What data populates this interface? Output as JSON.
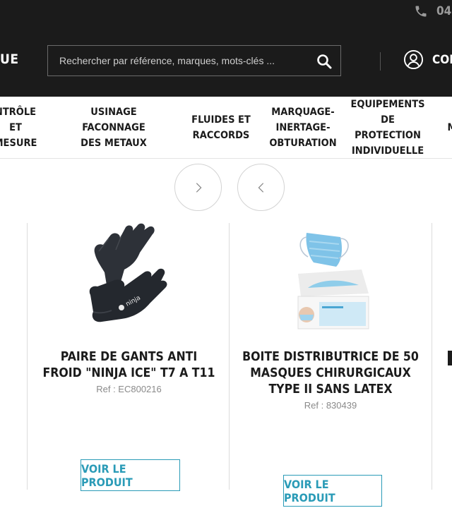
{
  "header": {
    "phone": "04",
    "brand_fragment": "UE",
    "search": {
      "placeholder": "Rechercher par référence, marques, mots-clés ..."
    },
    "account_label": "CONN"
  },
  "nav": {
    "items": [
      {
        "label": "NTRÔLE ET\nMESURE"
      },
      {
        "label": "USINAGE FACONNAGE\nDES METAUX"
      },
      {
        "label": "FLUIDES ET\nRACCORDS"
      },
      {
        "label": "MARQUAGE-\nINERTAGE-\nOBTURATION"
      },
      {
        "label": "EQUIPEMENTS DE\nPROTECTION\nINDIVIDUELLE"
      },
      {
        "label": "M"
      }
    ]
  },
  "carousel": {
    "next_icon": "chevron-right-icon",
    "prev_icon": "chevron-left-icon"
  },
  "products": [
    {
      "title": "PAIRE DE GANTS ANTI FROID \"NINJA ICE\" T7 A T11",
      "ref": "Ref : EC800216",
      "button": "VOIR LE PRODUIT",
      "image": "gloves-image"
    },
    {
      "title": "BOITE DISTRIBUTRICE DE 50 MASQUES CHIRURGICAUX TYPE II SANS LATEX",
      "ref": "Ref : 830439",
      "button": "VOIR LE PRODUIT",
      "image": "masks-box-image"
    }
  ],
  "colors": {
    "header_bg": "#1b1b1b",
    "accent": "#2a9bb7",
    "muted": "#8a8a8a"
  }
}
